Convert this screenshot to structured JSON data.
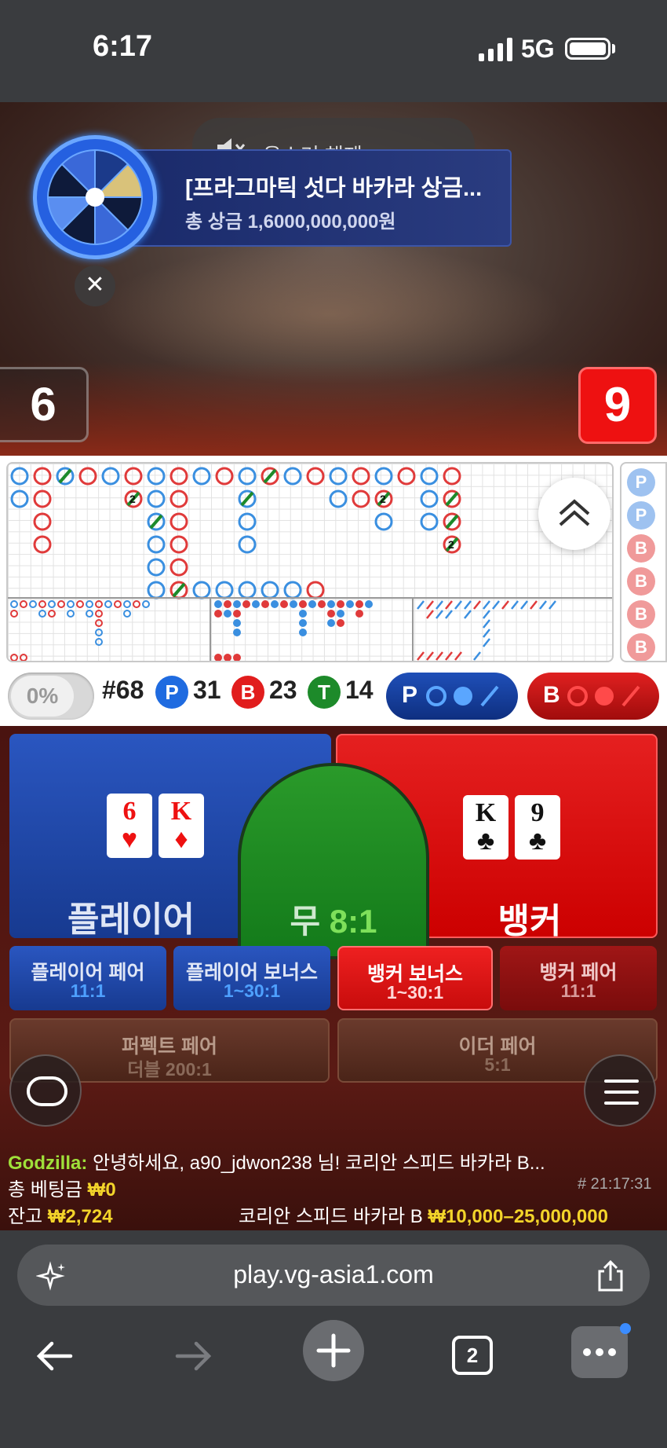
{
  "status_bar": {
    "time": "6:17",
    "network": "5G"
  },
  "video": {
    "mute_text": "음소거 해제",
    "promo_title": "[프라그마틱 섯다 바카라 상금...",
    "promo_prize": "총 상금 1,6000,000,000원",
    "player_score": "6",
    "banker_score": "9"
  },
  "roadmap": {
    "side_beads": [
      "P",
      "P",
      "B",
      "B",
      "B",
      "B"
    ]
  },
  "stats": {
    "percent": "0%",
    "round": "#68",
    "player_label": "P",
    "player_count": "31",
    "banker_label": "B",
    "banker_count": "23",
    "tie_label": "T",
    "tie_count": "14",
    "player_predict": "P",
    "banker_predict": "B"
  },
  "bets": {
    "player": {
      "label": "플레이어",
      "cards": [
        {
          "rank": "6",
          "suit": "♥"
        },
        {
          "rank": "K",
          "suit": "♦"
        }
      ]
    },
    "tie": {
      "label": "무",
      "odds": "8:1"
    },
    "banker": {
      "label": "뱅커",
      "cards": [
        {
          "rank": "K",
          "suit": "♣"
        },
        {
          "rank": "9",
          "suit": "♣"
        }
      ]
    },
    "player_pair": {
      "label": "플레이어 페어",
      "odds": "11:1"
    },
    "player_bonus": {
      "label": "플레이어 보너스",
      "odds": "1~30:1"
    },
    "banker_bonus": {
      "label": "뱅커 보너스",
      "odds": "1~30:1"
    },
    "banker_pair": {
      "label": "뱅커 페어",
      "odds": "11:1"
    },
    "perfect_pair": {
      "label": "퍼펙트 페어",
      "odds": "더블 200:1"
    },
    "either_pair": {
      "label": "이더 페어",
      "odds": "5:1"
    }
  },
  "info": {
    "chat_user": "Godzilla:",
    "chat_message": "안녕하세요, a90_jdwon238 님! 코리안 스피드 바카라 B...",
    "total_bet_label": "총 베팅금",
    "total_bet_value": "₩0",
    "game_id": "# 21:17:31",
    "balance_label": "잔고",
    "balance_value": "₩2,724",
    "table_name": "코리안 스피드 바카라 B",
    "table_limits": "₩10,000–25,000,000"
  },
  "browser": {
    "url": "play.vg-asia1.com",
    "tab_count": "2"
  },
  "colors": {
    "player_blue": "#1f4fb8",
    "banker_red": "#e11d1d",
    "tie_green": "#1d8a2a",
    "gold": "#f3d42a"
  }
}
